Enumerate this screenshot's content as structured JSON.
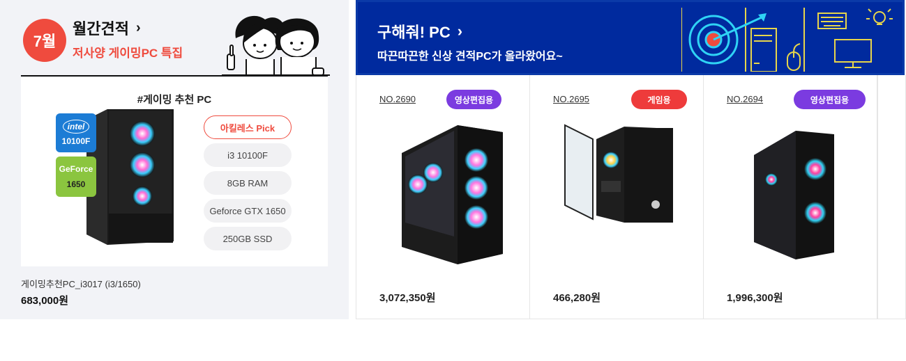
{
  "monthly": {
    "badge": "7월",
    "title": "월간견적",
    "title_chevron": "›",
    "subtitle": "저사양 게이밍PC 특집",
    "feature_heading": "#게이밍 추천 PC",
    "cpu_badge": {
      "logo": "intel",
      "model": "10100F",
      "color": "#1c7cd5"
    },
    "gpu_badge": {
      "logo": "GeForce",
      "model": "1650",
      "color": "#8bc53f"
    },
    "specs": [
      "아킬레스 Pick",
      "i3 10100F",
      "8GB RAM",
      "Geforce GTX 1650",
      "250GB SSD"
    ],
    "product_name": "게이밍추천PC_i3017 (i3/1650)",
    "product_price": "683,000원"
  },
  "banner": {
    "title": "구해줘! PC",
    "title_chevron": "›",
    "subtitle": "따끈따끈한 신상 견적PC가 올라왔어요~",
    "bg_color": "#002a9e",
    "art_icons": [
      "target-icon",
      "pc-tower-icon",
      "mouse-icon",
      "keyboard-icon",
      "monitor-icon",
      "lightbulb-icon"
    ]
  },
  "products": [
    {
      "no": "NO.2690",
      "tag": "영상편집용",
      "tag_color": "#7b3be0",
      "price": "3,072,350원"
    },
    {
      "no": "NO.2695",
      "tag": "게임용",
      "tag_color": "#ee3b3b",
      "price": "466,280원"
    },
    {
      "no": "NO.2694",
      "tag": "영상편집용",
      "tag_color": "#7b3be0",
      "price": "1,996,300원"
    }
  ],
  "colors": {
    "accent_red": "#ef4b3e",
    "banner_blue": "#002a9e",
    "panel_bg": "#f2f3f7"
  }
}
